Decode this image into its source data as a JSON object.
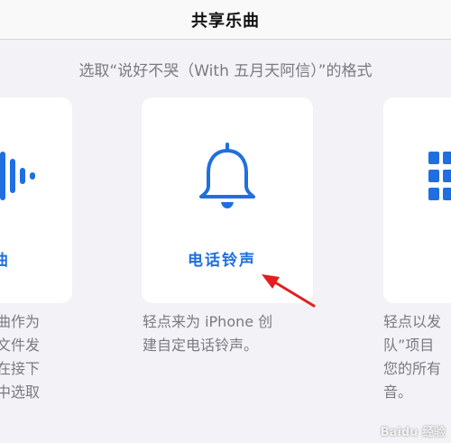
{
  "header": {
    "title": "共享乐曲"
  },
  "subtitle": "选取“说好不哭（With 五月天阿信）”的格式",
  "cards": {
    "left": {
      "label": "曲",
      "desc_lines": [
        "曲作为",
        "文件发",
        "在接下",
        "中选取"
      ]
    },
    "center": {
      "label": "电话铃声",
      "desc_lines": [
        "轻点来为 iPhone 创",
        "建自定电话铃声。"
      ]
    },
    "right": {
      "label": "",
      "desc_lines": [
        "轻点以发",
        "队”项目",
        "您的所有",
        "音。"
      ]
    }
  },
  "colors": {
    "accent": "#1f6fe0",
    "annotation_arrow": "#e02020"
  },
  "icons": {
    "left": "waveform-icon",
    "center": "bell-icon",
    "right": "list-icon"
  },
  "watermark": "Baidu 经验"
}
